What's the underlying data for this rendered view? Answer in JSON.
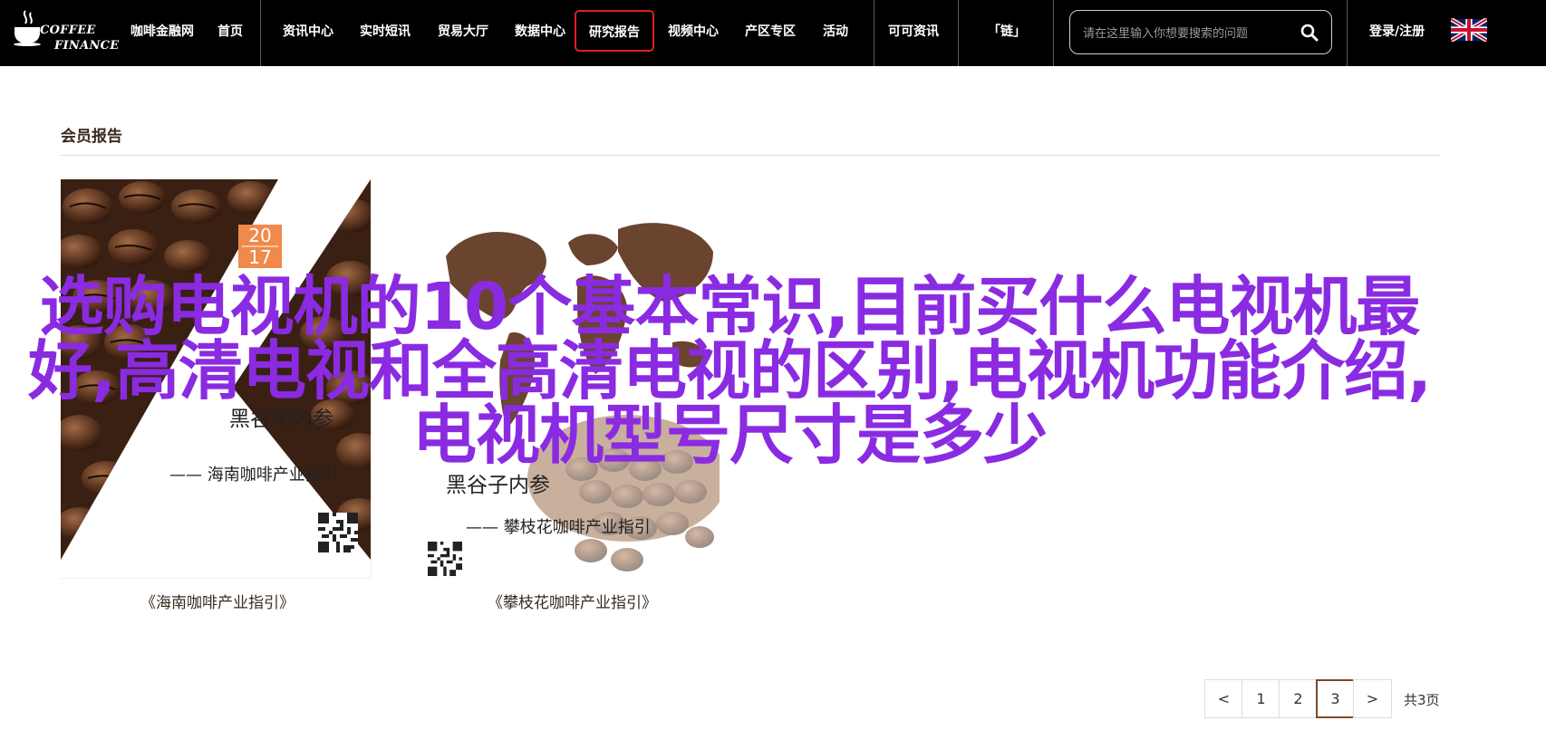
{
  "header": {
    "logo_line1": "COFFEE",
    "logo_line2": "FINANCE",
    "nav": [
      {
        "label": "咖啡金融网"
      },
      {
        "label": "首页"
      },
      {
        "label": "资讯中心"
      },
      {
        "label": "实时短讯"
      },
      {
        "label": "贸易大厅"
      },
      {
        "label": "数据中心"
      },
      {
        "label": "研究报告",
        "active": true
      },
      {
        "label": "视频中心"
      },
      {
        "label": "产区专区"
      },
      {
        "label": "活动"
      },
      {
        "label": "可可资讯"
      },
      {
        "label": "「链」"
      }
    ],
    "search_placeholder": "请在这里输入你想要搜索的问题",
    "login_label": "登录/注册",
    "flag_icon": "uk-flag-icon",
    "active_border_color": "#e02020"
  },
  "section": {
    "title": "会员报告"
  },
  "cards": [
    {
      "caption": "《海南咖啡产业指引》",
      "year_top": "20",
      "year_bottom": "17",
      "brand": "黑谷子内参",
      "subtitle": "—— 海南咖啡产业指引"
    },
    {
      "caption": "《攀枝花咖啡产业指引》",
      "brand": "黑谷子内参",
      "subtitle": "—— 攀枝花咖啡产业指引"
    }
  ],
  "headline": "选购电视机的10个基本常识,目前买什么电视机最好,高清电视和全高清电视的区别,电视机功能介绍,电视机型号尺寸是多少",
  "headline_color": "#8a2be2",
  "pagination": {
    "prev": "<",
    "pages": [
      "1",
      "2",
      "3"
    ],
    "current": "3",
    "next": ">",
    "total": "共3页"
  }
}
